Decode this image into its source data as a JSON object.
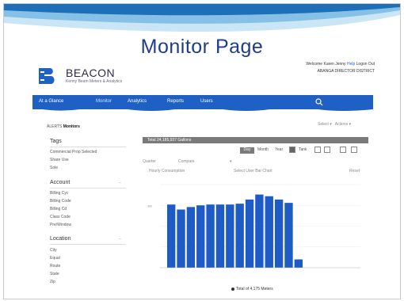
{
  "slide": {
    "title": "Monitor Page"
  },
  "brand": {
    "name": "BEACON",
    "tagline": "Kenny Beam Meters & Analytics"
  },
  "user": {
    "welcome": "Welcome Karen Jenny",
    "help": "Help",
    "logout": "Logon Out",
    "district": "ABANGA DIRECTOR DISTRICT"
  },
  "nav": {
    "items": [
      "At a Glance",
      "Monitor",
      "Analytics",
      "Reports",
      "Users"
    ]
  },
  "breadcrumb": {
    "prefix": "ALERTS",
    "current": "Monitors"
  },
  "pager": {
    "left": "Select",
    "right": "Actions"
  },
  "sidebar": {
    "tags_heading": "Tags",
    "tags": [
      "Commercial Prop Selected",
      "Share Use",
      "Sole"
    ],
    "account_heading": "Account",
    "account": [
      "Billing Cyc",
      "Billing Code",
      "Billing Cd",
      "Class Code",
      "Pre/Window"
    ],
    "location_heading": "Location",
    "location": [
      "City",
      "Equal",
      "Route",
      "State",
      "Zip"
    ]
  },
  "panel": {
    "title": "Total 24,185,937 Gallons",
    "tabs": [
      "Day",
      "Month",
      "Year"
    ],
    "extra": "Tank",
    "select_label": "Quarter",
    "select_value": "Compare",
    "subtitle_left": "Hourly Consumption",
    "subtitle_right": "Select User Bar Chart",
    "reset": "Reset"
  },
  "chart_data": {
    "type": "bar",
    "values": [
      0.76,
      0.7,
      0.73,
      0.75,
      0.76,
      0.76,
      0.76,
      0.77,
      0.82,
      0.88,
      0.86,
      0.82,
      0.78,
      0.1
    ],
    "ylim": [
      0,
      1.0
    ],
    "yticks": [
      "1M",
      "",
      "",
      ""
    ],
    "color": "#1f5bc6",
    "legend": "Total of 4,175 Meters"
  }
}
